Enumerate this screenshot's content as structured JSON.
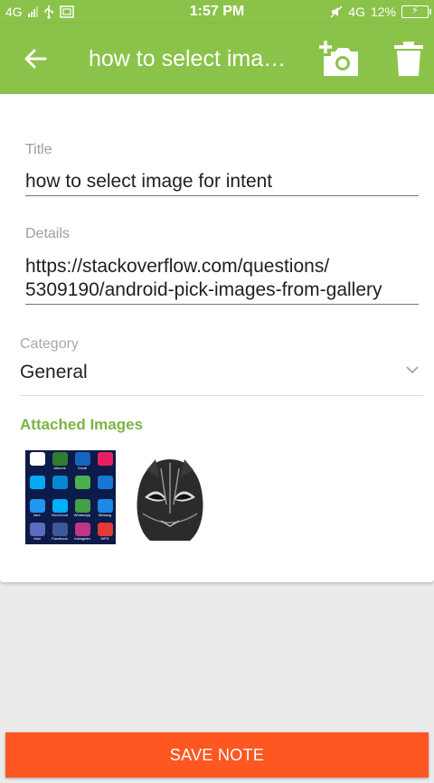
{
  "status_bar": {
    "network_left": "4G",
    "time": "1:57 PM",
    "network_right": "4G",
    "battery": "12%",
    "icons": [
      "signal-icon",
      "usb-icon",
      "screenshot-icon",
      "mute-icon",
      "battery-charging-icon"
    ]
  },
  "toolbar": {
    "title": "how to select image for intent",
    "back_icon": "arrow-back-icon",
    "add_photo_icon": "add-photo-icon",
    "delete_icon": "trash-icon"
  },
  "form": {
    "title_label": "Title",
    "title_value": "how to select image for intent",
    "details_label": "Details",
    "details_line1": "https://stackoverflow.com/questions/",
    "details_line2": "5309190/android-pick-images-from-gallery",
    "category_label": "Category",
    "category_value": "General"
  },
  "attachments": {
    "section_title": "Attached Images",
    "phone_apps": [
      "",
      "Albums",
      "Gmail",
      "",
      "",
      "",
      "",
      "",
      "ilare",
      "VivoCloud",
      "WhatsApp",
      "Messag",
      "Mail",
      "Facebook",
      "Instagram",
      "WPS"
    ]
  },
  "actions": {
    "save_label": "SAVE NOTE"
  },
  "colors": {
    "primary": "#8bc34a",
    "accent": "#ff5722",
    "section_title": "#7cb342"
  }
}
